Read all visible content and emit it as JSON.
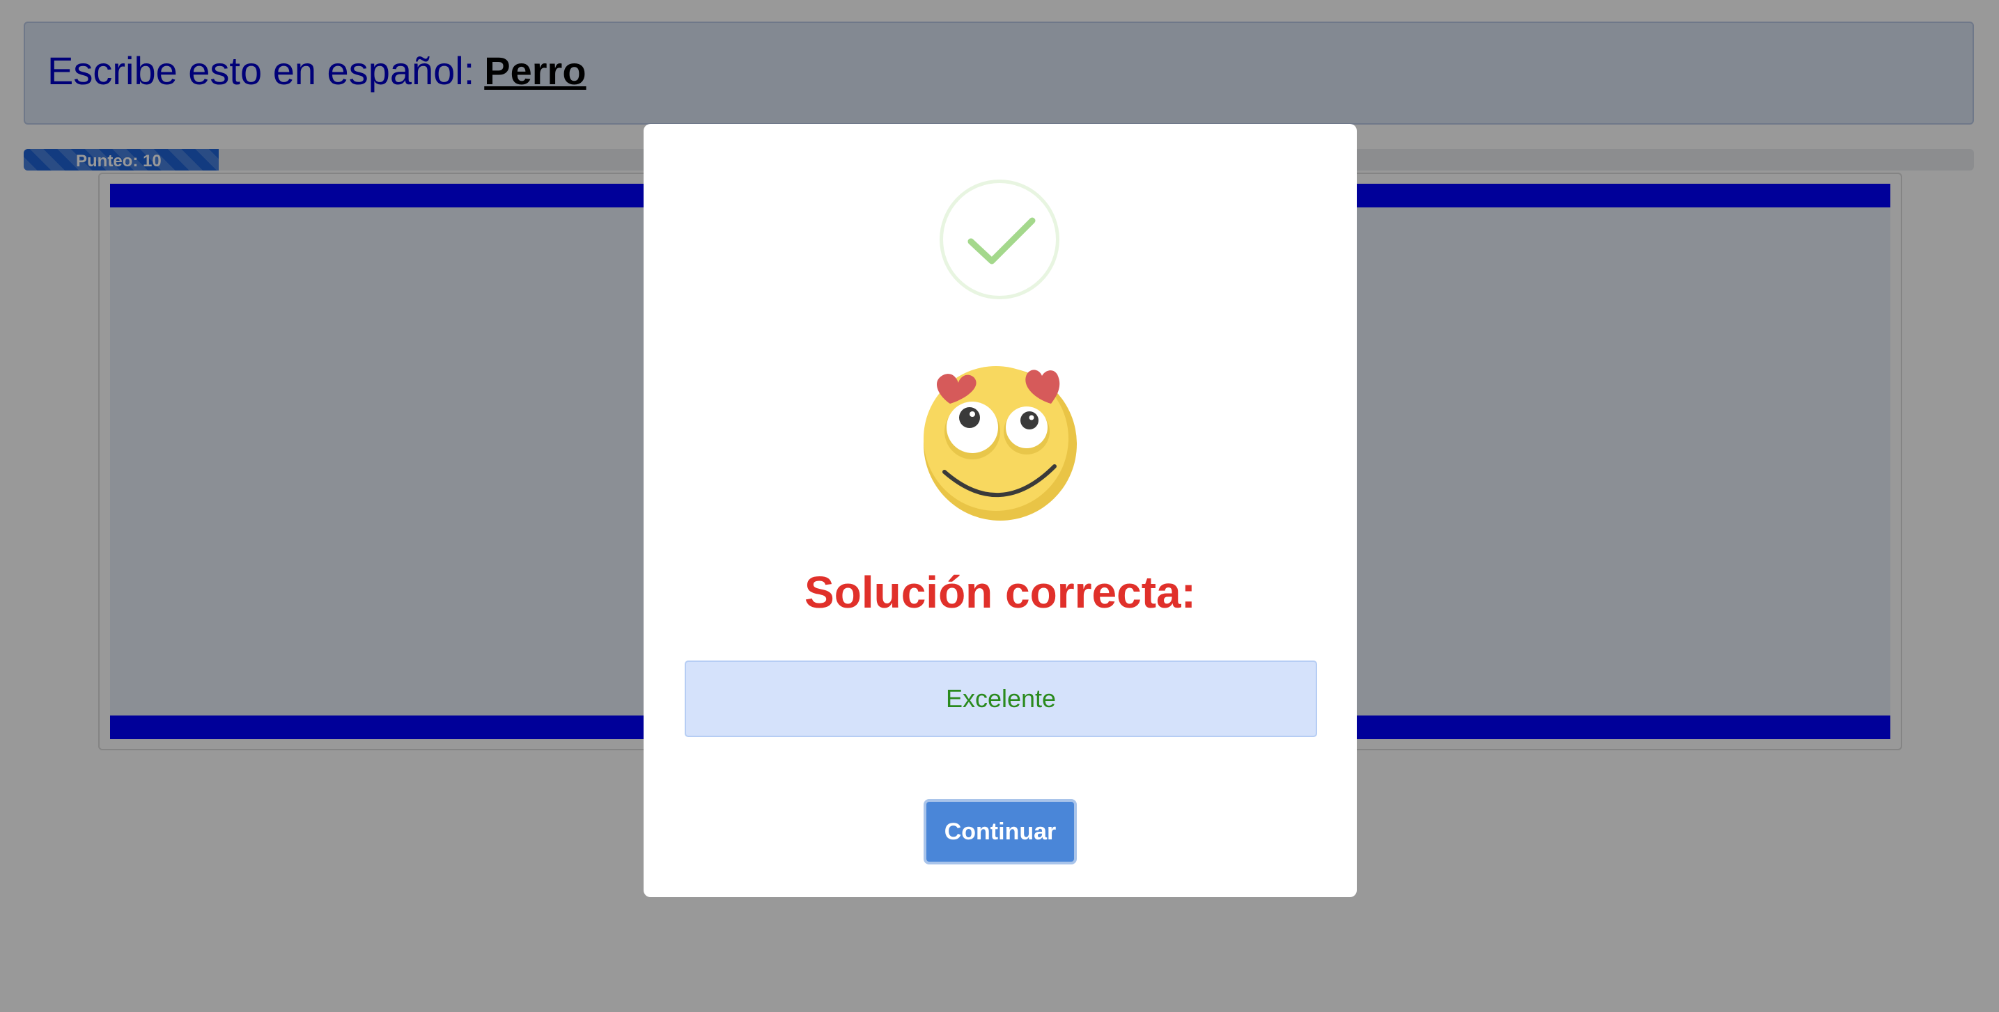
{
  "exercise": {
    "prompt": "Escribe esto en español:",
    "word": "Perro"
  },
  "score": {
    "label": "Punteo: 10",
    "progress_fraction": 0.1
  },
  "modal": {
    "status_icon": "checkmark-icon",
    "emoji": "heart-eyes-emoji",
    "title": "Solución correcta:",
    "solution": "Excelente",
    "continue_label": "Continuar"
  },
  "colors": {
    "prompt_text": "#0000c8",
    "band": "#0000ff",
    "progress": "#1f63d6",
    "title": "#e0302a",
    "solution_text": "#2a8a1d",
    "button": "#4a86d8",
    "check": "#a4d88c"
  }
}
